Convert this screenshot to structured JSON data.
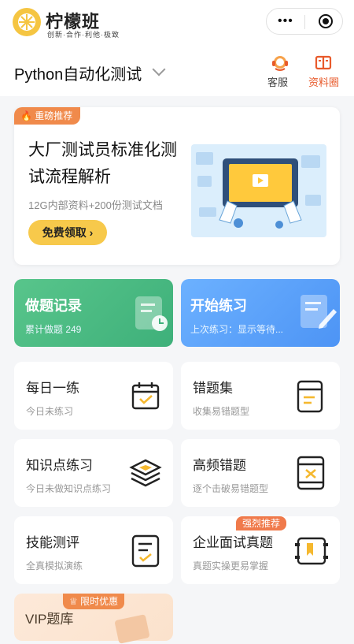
{
  "header": {
    "logo_title": "柠檬班",
    "logo_subtitle": "创新·合作·利他·极致",
    "capsule_more": "•••"
  },
  "course": {
    "name": "Python自动化测试",
    "service_label": "客服",
    "resources_label": "资料圈"
  },
  "banner": {
    "tag": "重磅推荐",
    "title": "大厂测试员标准化测试流程解析",
    "subtitle": "12G内部资料+200份测试文档",
    "button": "免费领取 ›"
  },
  "cards": {
    "record": {
      "title": "做题记录",
      "subtitle": "累计做题 249"
    },
    "start": {
      "title": "开始练习",
      "subtitle": "上次练习：显示等待..."
    },
    "daily": {
      "title": "每日一练",
      "subtitle": "今日未练习"
    },
    "wrong": {
      "title": "错题集",
      "subtitle": "收集易错题型"
    },
    "knowledge": {
      "title": "知识点练习",
      "subtitle": "今日未做知识点练习"
    },
    "frequent": {
      "title": "高频错题",
      "subtitle": "逐个击破易错题型"
    },
    "skill": {
      "title": "技能测评",
      "subtitle": "全真模拟演练"
    },
    "interview": {
      "title": "企业面试真题",
      "subtitle": "真题实操更易掌握",
      "badge": "强烈推荐"
    },
    "vip": {
      "title": "VIP题库",
      "badge": "限时优惠"
    }
  },
  "colors": {
    "accent": "#f08a4b",
    "green": "#4cbc85",
    "blue": "#5ca3fa",
    "button_yellow": "#f7c94b"
  }
}
